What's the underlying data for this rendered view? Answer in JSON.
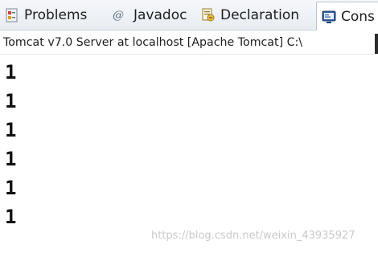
{
  "tabs": [
    {
      "label": "Problems",
      "icon": "problems-icon"
    },
    {
      "label": "Javadoc",
      "icon": "at-icon"
    },
    {
      "label": "Declaration",
      "icon": "declaration-icon"
    },
    {
      "label": "Cons",
      "icon": "console-icon"
    }
  ],
  "javadoc_icon_glyph": "@",
  "console": {
    "process_title": "Tomcat v7.0 Server at localhost [Apache Tomcat] C:\\",
    "lines": [
      "1",
      "1",
      "1",
      "1",
      "1",
      "1"
    ]
  },
  "watermark": "https://blog.csdn.net/weixin_43935927",
  "colors": {
    "tabbar_bg": "#e8edf3",
    "text": "#1e1e1e",
    "console_text": "#111111",
    "watermark": "#c9c9c9"
  }
}
